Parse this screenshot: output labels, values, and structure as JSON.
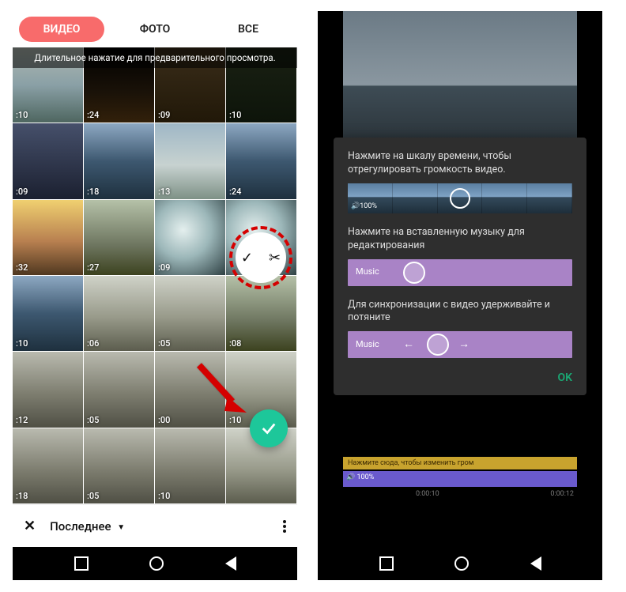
{
  "left": {
    "tabs": {
      "video": "ВИДЕО",
      "photo": "ФОТО",
      "all": "ВСЕ"
    },
    "hint": "Длительное нажатие для предварительного просмотра.",
    "durations": [
      ":10",
      ":24",
      ":09",
      ":10",
      ":09",
      ":18",
      ":13",
      ":24",
      ":32",
      ":27",
      ":09",
      "",
      ":10",
      ":06",
      ":05",
      ":08",
      ":12",
      ":05",
      ":00",
      ":10",
      ":18",
      ":05",
      ":10",
      ""
    ],
    "bottom": {
      "close": "✕",
      "title": "Последнее"
    }
  },
  "right": {
    "dialog": {
      "text1": "Нажмите на шкалу времени, чтобы отрегулировать громкость видео.",
      "vol_label": "100%",
      "text2": "Нажмите на вставленную музыку для редактирования",
      "music_label": "Music",
      "text3": "Для синхронизации с видео удерживайте и потяните",
      "ok": "OK"
    },
    "timeline": {
      "hint": "Нажмите сюда, чтобы изменить гром",
      "vol": "100%",
      "t0": "0:00:10",
      "t1": "0:00:12"
    }
  },
  "icons": {
    "check": "✓",
    "scissors": "✂",
    "speaker": "🔊",
    "dropdown": "▼"
  }
}
